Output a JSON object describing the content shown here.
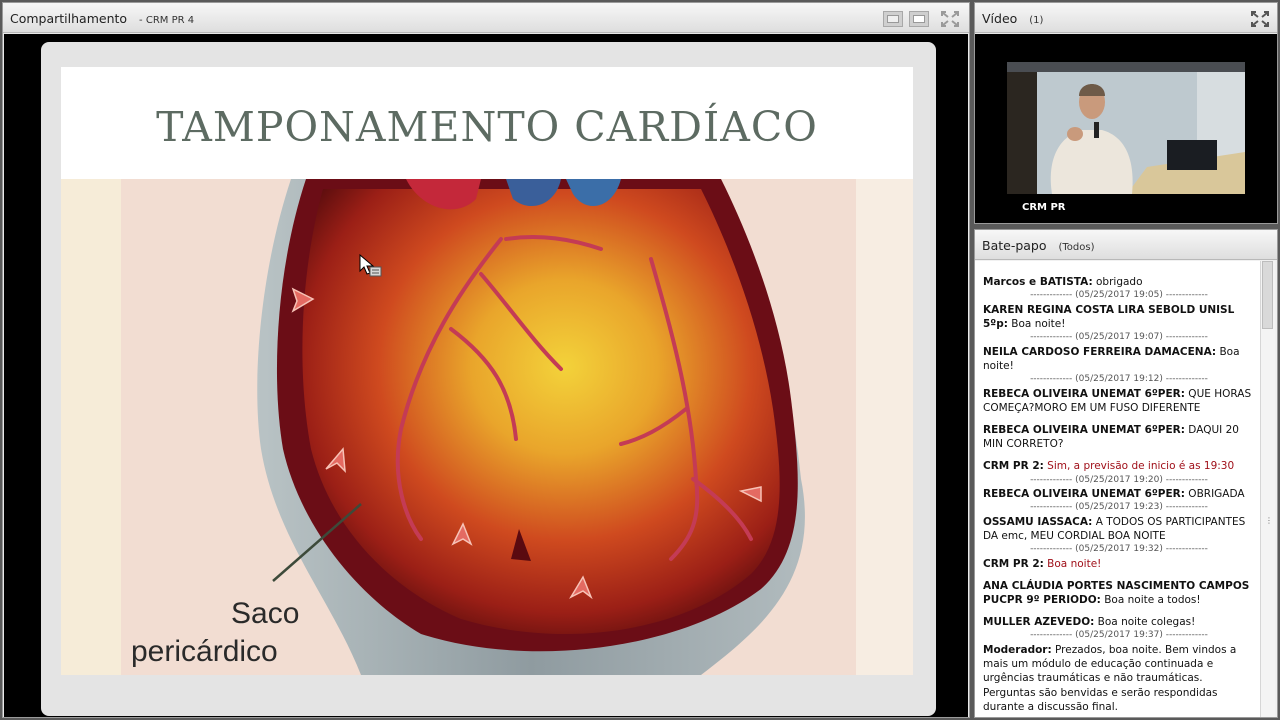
{
  "share_pod": {
    "title": "Compartilhamento",
    "subtitle": "- CRM PR 4",
    "slide": {
      "title": "TAMPONAMENTO CARDÍACO",
      "label_line1": "Saco",
      "label_line2": "pericárdico"
    }
  },
  "video_pod": {
    "title": "Vídeo",
    "count": "(1)",
    "participant_name": "CRM PR"
  },
  "chat_pod": {
    "title": "Bate-papo",
    "scope": "(Todos)",
    "messages": [
      {
        "sender": "Marcos e BATISTA:",
        "text": " obrigado",
        "ts": "------------- (05/25/2017 19:05) -------------"
      },
      {
        "sender": "KAREN REGINA COSTA LIRA SEBOLD UNISL 5ºp:",
        "text": " Boa noite!",
        "ts": "------------- (05/25/2017 19:07) -------------"
      },
      {
        "sender": "NEILA CARDOSO FERREIRA DAMACENA:",
        "text": " Boa noite!",
        "ts": "------------- (05/25/2017 19:12) -------------"
      },
      {
        "sender": "REBECA OLIVEIRA UNEMAT 6ºPER:",
        "text": " QUE HORAS COMEÇA?MORO EM UM FUSO DIFERENTE",
        "ts": ""
      },
      {
        "sender": "REBECA OLIVEIRA UNEMAT 6ºPER:",
        "text": " DAQUI 20 MIN CORRETO?",
        "ts": ""
      },
      {
        "sender": "CRM PR 2:",
        "text": " Sim, a previsão de inicio é as 19:30",
        "ts": "------------- (05/25/2017 19:20) -------------"
      },
      {
        "sender": "REBECA OLIVEIRA UNEMAT 6ºPER:",
        "text": " OBRIGADA",
        "ts": "------------- (05/25/2017 19:23) -------------"
      },
      {
        "sender": "OSSAMU   IASSACA:",
        "text": " A TODOS OS PARTICIPANTES DA emc, MEU CORDIAL BOA NOITE",
        "ts": "------------- (05/25/2017 19:32) -------------"
      },
      {
        "sender": "CRM PR 2:",
        "text": " Boa noite!",
        "ts": ""
      },
      {
        "sender": "ANA CLÁUDIA PORTES NASCIMENTO CAMPOS PUCPR 9º PERIODO:",
        "text": " Boa noite a todos!",
        "ts": ""
      },
      {
        "sender": "MULLER AZEVEDO:",
        "text": " Boa noite colegas!",
        "ts": "------------- (05/25/2017 19:37) -------------"
      },
      {
        "sender": "Moderador:",
        "text": " Prezados, boa noite. Bem vindos a mais um módulo de educação continuada e urgências traumáticas e não traumáticas. Perguntas são benvidas e serão respondidas durante a discussão final.",
        "ts": ""
      }
    ]
  },
  "colors": {
    "moderator_red": "#a0101a",
    "slide_title": "#5d6b62"
  },
  "icons": [
    "fullscreen-icon",
    "layout-single-icon",
    "layout-dual-icon",
    "cursor-icon",
    "scroll-tick-icon"
  ]
}
